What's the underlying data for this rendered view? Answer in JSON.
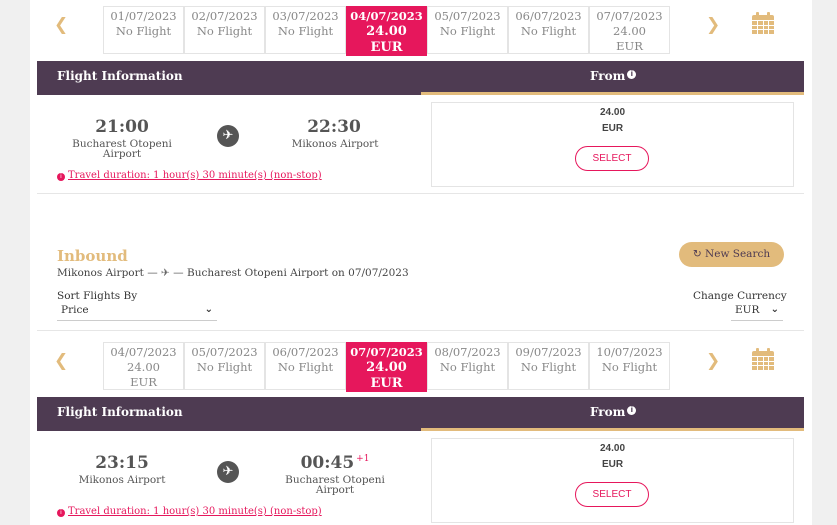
{
  "outbound": {
    "dates": [
      {
        "date": "01/07/2023",
        "line2": "No Flight",
        "line3": ""
      },
      {
        "date": "02/07/2023",
        "line2": "No Flight",
        "line3": ""
      },
      {
        "date": "03/07/2023",
        "line2": "No Flight",
        "line3": ""
      },
      {
        "date": "04/07/2023",
        "line2": "24.00",
        "line3": "EUR",
        "selected": true
      },
      {
        "date": "05/07/2023",
        "line2": "No Flight",
        "line3": ""
      },
      {
        "date": "06/07/2023",
        "line2": "No Flight",
        "line3": ""
      },
      {
        "date": "07/07/2023",
        "line2": "24.00",
        "line3": "EUR"
      }
    ],
    "header": {
      "title": "Flight Information",
      "from": "From"
    },
    "flight": {
      "dep_time": "21:00",
      "dep_airport_1": "Bucharest Otopeni",
      "dep_airport_2": "Airport",
      "arr_time": "22:30",
      "arr_airport_1": "Mikonos Airport",
      "arr_airport_2": "",
      "arr_plus": "",
      "duration": "Travel duration: 1 hour(s) 30 minute(s) (non-stop)",
      "price": "24.00",
      "currency": "EUR",
      "select_label": "SELECT"
    }
  },
  "inbound": {
    "title": "Inbound",
    "route_from": "Mikonos Airport",
    "route_to": "Bucharest Otopeni Airport on 07/07/2023",
    "new_search": "New Search",
    "sort_label": "Sort Flights By",
    "sort_value": "Price",
    "currency_label": "Change Currency",
    "currency_value": "EUR",
    "dates": [
      {
        "date": "04/07/2023",
        "line2": "24.00",
        "line3": "EUR"
      },
      {
        "date": "05/07/2023",
        "line2": "No Flight",
        "line3": ""
      },
      {
        "date": "06/07/2023",
        "line2": "No Flight",
        "line3": ""
      },
      {
        "date": "07/07/2023",
        "line2": "24.00",
        "line3": "EUR",
        "selected": true
      },
      {
        "date": "08/07/2023",
        "line2": "No Flight",
        "line3": ""
      },
      {
        "date": "09/07/2023",
        "line2": "No Flight",
        "line3": ""
      },
      {
        "date": "10/07/2023",
        "line2": "No Flight",
        "line3": ""
      }
    ],
    "header": {
      "title": "Flight Information",
      "from": "From"
    },
    "flight": {
      "dep_time": "23:15",
      "dep_airport_1": "Mikonos Airport",
      "dep_airport_2": "",
      "arr_time": "00:45",
      "arr_airport_1": "Bucharest Otopeni",
      "arr_airport_2": "Airport",
      "arr_plus": "+1",
      "duration": "Travel duration: 1 hour(s) 30 minute(s) (non-stop)",
      "price": "24.00",
      "currency": "EUR",
      "select_label": "SELECT"
    }
  },
  "icons": {
    "prev": "chevron-left-icon",
    "next": "chevron-right-icon",
    "calendar": "calendar-icon",
    "plane": "airplane-icon",
    "info": "info-icon",
    "refresh": "refresh-icon"
  },
  "colors": {
    "accent": "#e6175c",
    "gold": "#e2bb7c",
    "header": "#4e3b52"
  }
}
